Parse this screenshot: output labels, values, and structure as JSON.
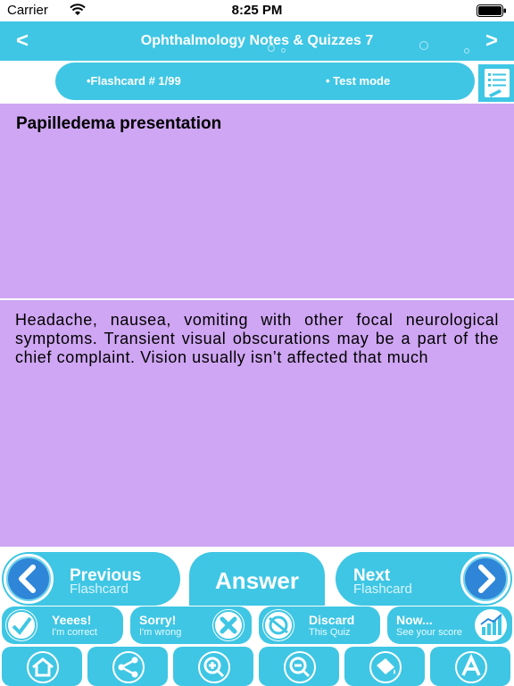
{
  "status_bar": {
    "carrier": "Carrier",
    "time": "8:25 PM"
  },
  "nav": {
    "title": "Ophthalmology Notes & Quizzes 7",
    "back": "<",
    "forward": ">"
  },
  "subheader": {
    "flashcard_label": "•Flashcard #  1/99",
    "mode_label": "• Test mode"
  },
  "question": {
    "text": "Papilledema presentation"
  },
  "answer": {
    "text": "Headache, nausea, vomiting with other focal neurological symptoms. Transient visual obscurations may be a part of the chief complaint. Vision usually isn’t affected that much"
  },
  "actions": {
    "previous_main": "Previous",
    "previous_sub": "Flashcard",
    "answer": "Answer",
    "next_main": "Next",
    "next_sub": "Flashcard"
  },
  "status_row": [
    {
      "main": "Yeees!",
      "sub": "I'm correct"
    },
    {
      "main": "Sorry!",
      "sub": "I'm wrong"
    },
    {
      "main": "Discard",
      "sub": "This Quiz"
    },
    {
      "main": "Now...",
      "sub": "See your score"
    }
  ],
  "tools": [
    "home-icon",
    "share-icon",
    "zoom-in-icon",
    "zoom-out-icon",
    "paint-bucket-icon",
    "text-size-icon"
  ],
  "colors": {
    "accent": "#3fc6e4",
    "panel": "#cfa6f3",
    "nav_circle": "#2f86d8"
  }
}
